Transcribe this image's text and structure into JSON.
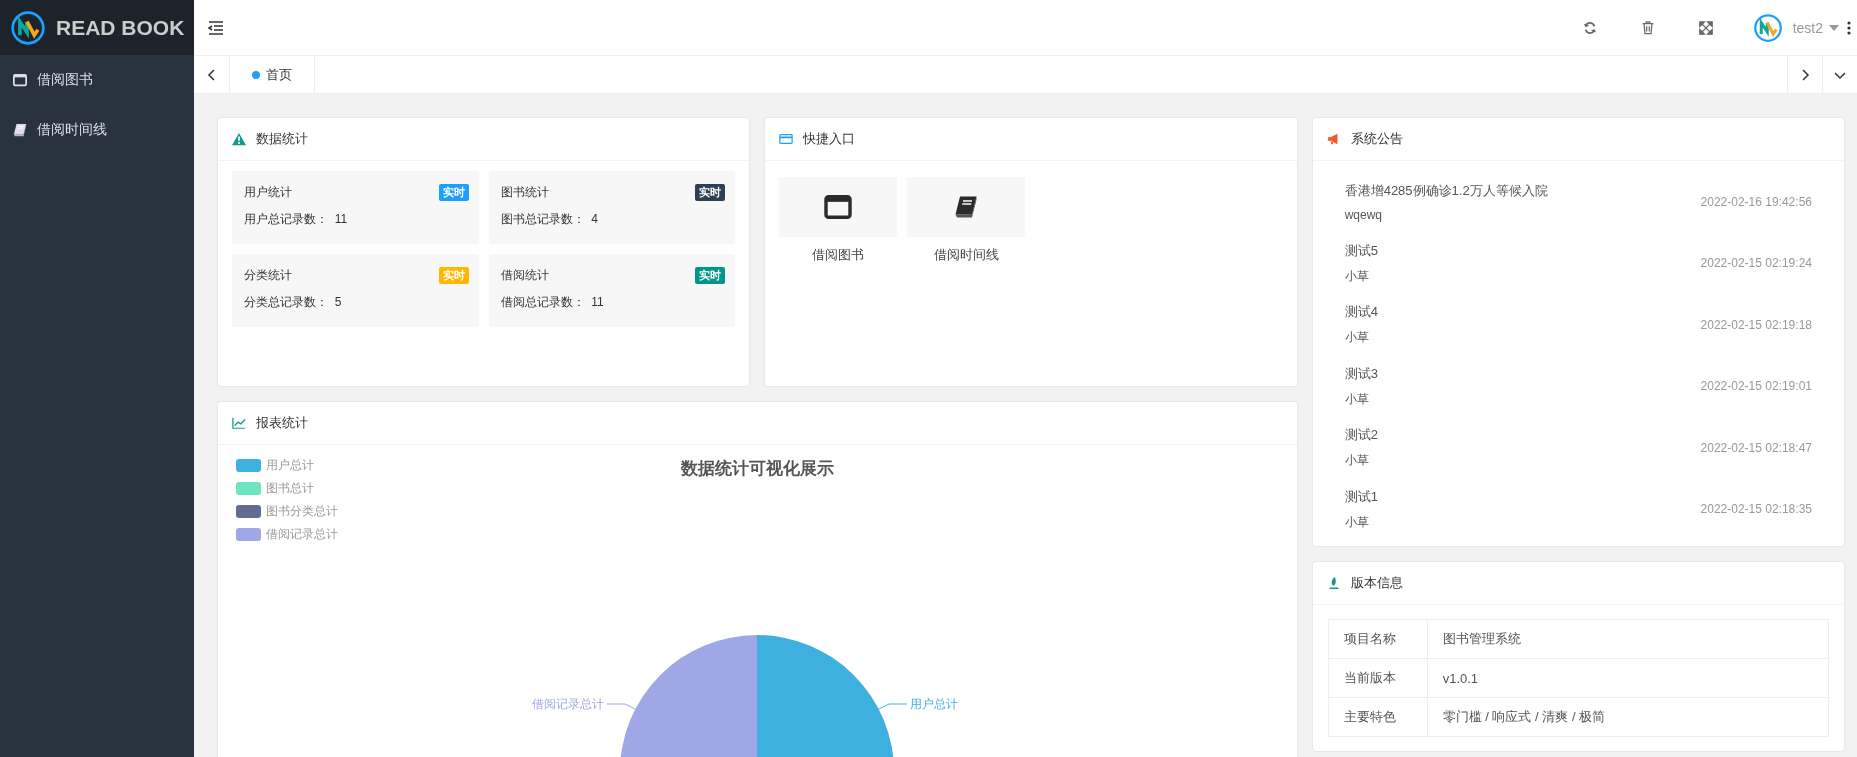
{
  "brand": {
    "name": "READ BOOK"
  },
  "sidebar": {
    "items": [
      {
        "label": "借阅图书",
        "selected": false
      },
      {
        "label": "借阅时间线",
        "selected": false
      }
    ]
  },
  "header": {
    "user": "test2"
  },
  "tabs": [
    {
      "label": "首页",
      "selected": true
    }
  ],
  "stats": {
    "title": "数据统计",
    "tiles": [
      {
        "title": "用户统计",
        "badge": "实时",
        "color": "#1e9fff",
        "caption": "用户总记录数：",
        "count": "11"
      },
      {
        "title": "图书统计",
        "badge": "实时",
        "color": "#2f4056",
        "caption": "图书总记录数：",
        "count": "4"
      },
      {
        "title": "分类统计",
        "badge": "实时",
        "color": "#ffb800",
        "caption": "分类总记录数：",
        "count": "5"
      },
      {
        "title": "借阅统计",
        "badge": "实时",
        "color": "#009688",
        "caption": "借阅总记录数：",
        "count": "11"
      }
    ]
  },
  "quick": {
    "title": "快捷入口",
    "items": [
      {
        "label": "借阅图书"
      },
      {
        "label": "借阅时间线"
      }
    ]
  },
  "notices": {
    "title": "系统公告",
    "items": [
      {
        "title": "香港增4285例确诊1.2万人等候入院",
        "author": "wqewq",
        "time": "2022-02-16 19:42:56"
      },
      {
        "title": "测试5",
        "author": "小草",
        "time": "2022-02-15 02:19:24"
      },
      {
        "title": "测试4",
        "author": "小草",
        "time": "2022-02-15 02:19:18"
      },
      {
        "title": "测试3",
        "author": "小草",
        "time": "2022-02-15 02:19:01"
      },
      {
        "title": "测试2",
        "author": "小草",
        "time": "2022-02-15 02:18:47"
      },
      {
        "title": "测试1",
        "author": "小草",
        "time": "2022-02-15 02:18:35"
      }
    ]
  },
  "report": {
    "title": "报表统计",
    "chart_title": "数据统计可视化展示",
    "legend": [
      {
        "label": "用户总计",
        "color": "#3eb0e0"
      },
      {
        "label": "图书总计",
        "color": "#6ce5c0"
      },
      {
        "label": "图书分类总计",
        "color": "#626c91"
      },
      {
        "label": "借阅记录总计",
        "color": "#a0a7e6"
      }
    ],
    "slice_labels": [
      {
        "label": "借阅记录总计",
        "color": "#a0a7e6"
      },
      {
        "label": "用户总计",
        "color": "#3eb0e0"
      }
    ]
  },
  "version": {
    "title": "版本信息",
    "rows": [
      {
        "key": "项目名称",
        "value": "图书管理系统"
      },
      {
        "key": "当前版本",
        "value": "v1.0.1"
      },
      {
        "key": "主要特色",
        "value": "零门槛 / 响应式 / 清爽 / 极简"
      }
    ]
  }
}
